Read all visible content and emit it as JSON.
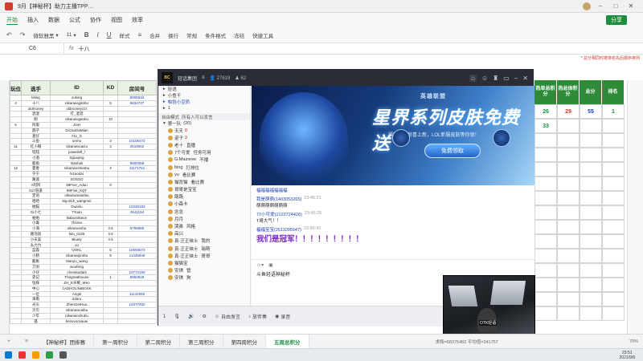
{
  "titlebar": {
    "title": "9月【神秘杯】助力主播TPP…"
  },
  "menubar": {
    "items": [
      "开始",
      "插入",
      "数据",
      "公式",
      "协作",
      "视图",
      "效率"
    ],
    "share": "分享"
  },
  "ribbon": {
    "font": "微软雅黑",
    "size": "11",
    "items": [
      "样式",
      "合并",
      "换行",
      "常规",
      "条件格式",
      "冻结",
      "快捷工具"
    ]
  },
  "formula": {
    "cell": "C6",
    "value": "十八"
  },
  "notes": {
    "top_right": "* 总分相同时按排名先后顺序排列"
  },
  "sheet": {
    "headers": [
      "玩位",
      "选手",
      "ID",
      "KD",
      "房间号"
    ],
    "rows": [
      [
        "",
        "kiting",
        "xuking",
        "",
        "8005534"
      ],
      [
        "4",
        "十八",
        "nikanwoganbu",
        "5",
        "6834737"
      ],
      [
        "",
        "oldmoney",
        "oldmoneyzzz",
        "",
        ""
      ],
      [
        "",
        "混混",
        "打_混混",
        "",
        ""
      ],
      [
        "",
        "刚",
        "nikanwoganbu",
        "10",
        ""
      ],
      [
        "6",
        "阿俊",
        "JiaH",
        "",
        ""
      ],
      [
        "",
        "圆子",
        "DzzaoDaMian",
        "",
        ""
      ],
      [
        "",
        "基仔",
        "711_G",
        "",
        ""
      ],
      [
        "",
        "斗鱼",
        "umnu",
        "3",
        "10105472"
      ],
      [
        "11",
        "红小帽",
        "nikanwocaizu",
        "3",
        "2519052"
      ],
      [
        "",
        "钰钰",
        "jiaweilefl_l",
        "",
        ""
      ],
      [
        "",
        "小酒",
        "Sjijiuqing",
        "",
        ""
      ],
      [
        "",
        "鹿角",
        "Nanhali",
        "",
        "8800368"
      ],
      [
        "12",
        "夏春",
        "nikanwoshenbu",
        "4",
        "11171761"
      ],
      [
        "",
        "宁宁",
        "lx1aodai",
        "",
        ""
      ],
      [
        "",
        "路遥",
        "SOSSO",
        "",
        ""
      ],
      [
        "",
        "A阿阿",
        "99Five_Aduu",
        "0",
        ""
      ],
      [
        "",
        "517逍遥",
        "99Five_XQT",
        "",
        ""
      ],
      [
        "",
        "定语",
        "nikanwonianbu",
        "",
        ""
      ],
      [
        "",
        "哈哈",
        "big-dick_wangmei",
        "",
        ""
      ],
      [
        "",
        "她猫",
        "Duanlu",
        "",
        "10235183"
      ],
      [
        "",
        "Gi小七",
        "7Yuan",
        "",
        "3641194"
      ],
      [
        "",
        "帕帕",
        "Babomi6aun",
        "",
        ""
      ],
      [
        "",
        "小毒",
        "7bsssx",
        "",
        ""
      ],
      [
        "",
        "小海",
        "nikanwoshu",
        "3.5",
        "9755885"
      ],
      [
        "",
        "路泡浪",
        "fulu_0125",
        "3.5",
        ""
      ],
      [
        "",
        "小天美",
        "Bluely",
        "3.5",
        ""
      ],
      [
        "",
        "幺力力",
        "uu",
        "",
        ""
      ],
      [
        "",
        "蓝森",
        "OOKL",
        "5",
        "10669573"
      ],
      [
        "",
        "小鹤",
        "nikanwojimbu",
        "5",
        "11335948"
      ],
      [
        "",
        "膨胀",
        "Manyu_wang",
        "",
        ""
      ],
      [
        "",
        "刀剑",
        "woofeng",
        "",
        ""
      ],
      [
        "",
        "小仔",
        "chenlaodai3",
        "",
        "10770159"
      ],
      [
        "",
        "史记",
        "Thegreathouse",
        "1",
        "8950818"
      ],
      [
        "",
        "恒辉",
        "ZH_E水柳_Wen",
        "",
        ""
      ],
      [
        "",
        "中心",
        "1ADHOLINIBOSK",
        "",
        ""
      ],
      [
        "",
        "一位",
        "Angel",
        "",
        "11142060"
      ],
      [
        "",
        "海南",
        "2daru",
        "",
        ""
      ],
      [
        "",
        "光头",
        "ZhenGetHuu",
        "",
        "10377400"
      ],
      [
        "",
        "贝贝",
        "nikanwocaibu",
        "",
        ""
      ],
      [
        "",
        "少年",
        "nikanwoshubu",
        "",
        ""
      ],
      [
        "",
        "孤",
        "kenvvoceauw",
        "",
        ""
      ]
    ]
  },
  "right_cols": {
    "headers": [
      "热单总积分",
      "热总体积分",
      "总分",
      "排名"
    ],
    "rows": [
      [
        "26",
        "29",
        "55",
        "1"
      ],
      [
        "33",
        "",
        "",
        ""
      ],
      [
        "",
        "",
        "",
        ""
      ],
      [
        "",
        "",
        "",
        ""
      ],
      [
        "",
        "",
        "",
        ""
      ],
      [
        "",
        "",
        "",
        ""
      ],
      [
        "",
        "",
        "",
        ""
      ],
      [
        "",
        "",
        "",
        ""
      ],
      [
        "",
        "",
        "",
        ""
      ],
      [
        "",
        "",
        "",
        ""
      ],
      [
        "",
        "",
        "",
        ""
      ],
      [
        "",
        "",
        "",
        ""
      ],
      [
        "",
        "",
        "",
        ""
      ],
      [
        "",
        "",
        "",
        ""
      ],
      [
        "",
        "",
        "",
        ""
      ]
    ]
  },
  "sheet_tabs": {
    "tabs": [
      "【神秘杯】团排赛",
      "第一周积分",
      "第二周积分",
      "第三周积分",
      "第四周积分",
      "五周总积分"
    ],
    "active": 5,
    "status": "求和=68375482 平均值=341757",
    "zoom": "70%"
  },
  "taskbar": {
    "time": "23:51",
    "date": "2021/9/9"
  },
  "live": {
    "room_logo": "BC",
    "room_name": "轻话集团",
    "viewers": "27619",
    "subs": "62",
    "channels": [
      "轻语",
      "小鱼干",
      "帕恰小豆奶",
      "1"
    ],
    "section_label": "自由模式",
    "section_hint": "所有人可以发言",
    "group": "第一队",
    "group_count": "(20)",
    "users": [
      [
        "夭夭",
        "8",
        ""
      ],
      [
        "诺子",
        "9",
        ""
      ],
      [
        "老十",
        "",
        "直播"
      ],
      [
        "7个可爱",
        "",
        "任务可用"
      ],
      [
        "G.Mazoree",
        "",
        "不播"
      ],
      [
        "bing",
        "",
        "打排位"
      ],
      [
        "yu",
        "",
        "看比赛"
      ],
      [
        "猫背猫",
        "",
        "看比赛"
      ],
      [
        "哥哥是宝宝",
        "",
        ""
      ],
      [
        "路路",
        "",
        ""
      ],
      [
        "小森卡",
        "",
        ""
      ],
      [
        "念念",
        "",
        ""
      ],
      [
        "月月",
        "",
        ""
      ],
      [
        "哭鼻",
        "",
        "风格"
      ],
      [
        "高兴",
        "",
        ""
      ],
      [
        "真·正正峡士",
        "",
        "我的"
      ],
      [
        "真·正正峡士",
        "",
        "瑞萌"
      ],
      [
        "真·正正峡士",
        "",
        "哥哥"
      ],
      [
        "猫猫宝",
        "",
        ""
      ],
      [
        "安琪",
        "",
        "管"
      ],
      [
        "安琪",
        "",
        "狗"
      ]
    ],
    "banner": {
      "brand": "英雄联盟",
      "headline": "星界系列皮肤免费送",
      "sub": "福利大厅惊喜上新，LOL新服皮肤等你领！",
      "claim": "免费领取"
    },
    "chat": [
      {
        "user": "福福福福福福福",
        "time": "",
        "text": ""
      },
      {
        "user": "我是萌萌(1403053265)",
        "time": "23:45:21",
        "text": "萌萌萌萌萌萌萌"
      },
      {
        "user": "77小可爱(2122724426)",
        "time": "23:45:25",
        "text": "T哥大气！！"
      },
      {
        "user": "福福宝宝(2611095647)",
        "time": "23:50:42",
        "text": "我们是冠军！！！！！！！！！"
      }
    ],
    "input_text": "斗鱼轻语神秘杯",
    "bottom": [
      "1",
      "",
      "",
      "",
      "",
      "自由发言",
      "",
      "放伴奏",
      "",
      "录音"
    ],
    "cam_tag": "OTK轻语"
  }
}
